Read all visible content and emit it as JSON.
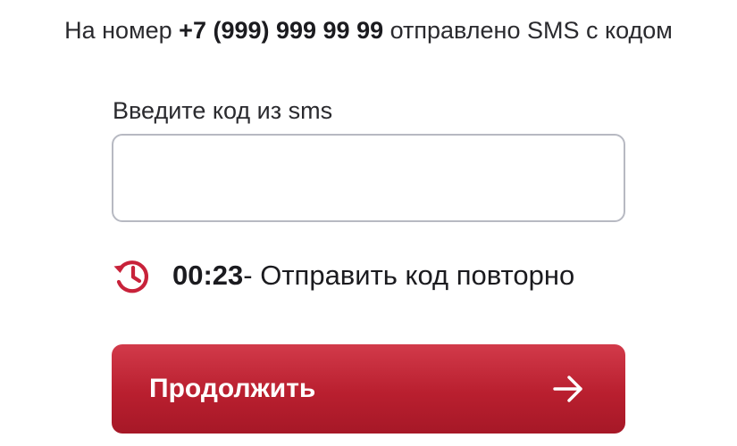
{
  "info": {
    "prefix": "На номер ",
    "phone": "+7 (999) 999 99 99",
    "suffix": " отправлено SMS с кодом"
  },
  "code_field": {
    "label": "Введите код из sms",
    "value": "",
    "placeholder": ""
  },
  "resend": {
    "icon": "history-clock-icon",
    "timer": "00:23",
    "link_text": "- Отправить код повторно"
  },
  "continue_button": {
    "label": "Продолжить",
    "icon": "arrow-right-icon"
  },
  "colors": {
    "accent": "#c12535",
    "icon": "#c8223a",
    "input_border": "#b7b9c2",
    "text": "#1b1b1f"
  }
}
